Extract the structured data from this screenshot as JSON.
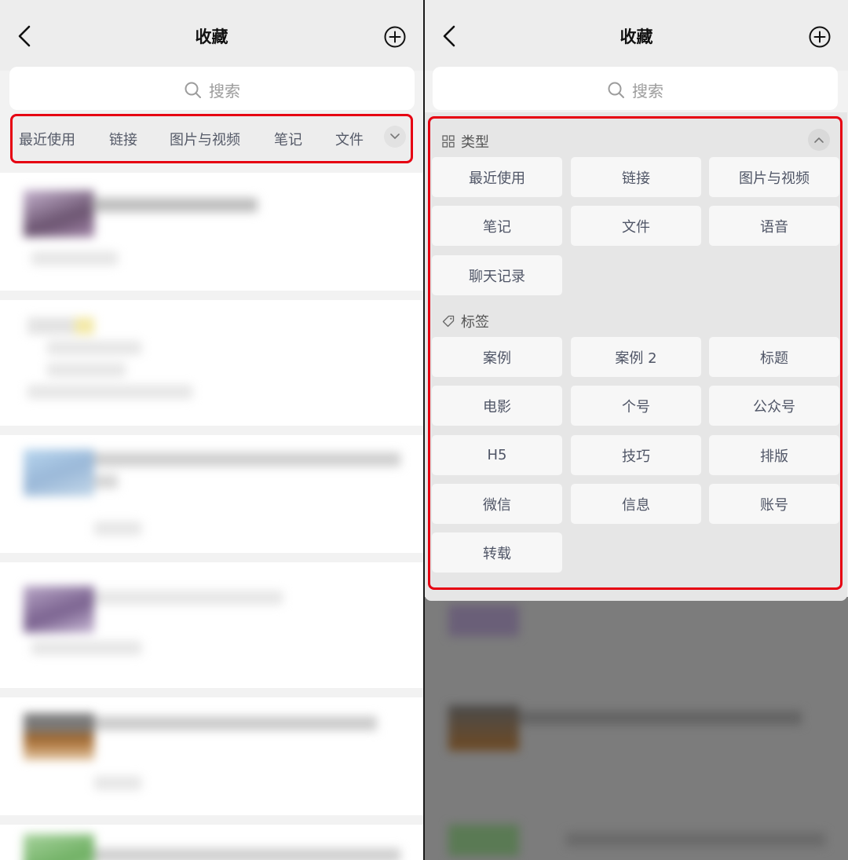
{
  "header": {
    "title": "收藏"
  },
  "search": {
    "placeholder": "搜索"
  },
  "categories": [
    "最近使用",
    "链接",
    "图片与视频",
    "笔记",
    "文件"
  ],
  "dropdown": {
    "types_heading": "类型",
    "types": [
      "最近使用",
      "链接",
      "图片与视频",
      "笔记",
      "文件",
      "语音",
      "聊天记录"
    ],
    "tags_heading": "标签",
    "tags": [
      "案例",
      "案例 2",
      "标题",
      "电影",
      "个号",
      "公众号",
      "H5",
      "技巧",
      "排版",
      "微信",
      "信息",
      "账号",
      "转载"
    ]
  },
  "colors": {
    "highlight": "#e60012",
    "chip_text": "#4f5566",
    "background": "#ededed"
  },
  "icons": [
    "back-icon",
    "add-circle-icon",
    "search-icon",
    "chevron-down-icon",
    "chevron-up-icon",
    "grid-icon",
    "tag-icon"
  ]
}
